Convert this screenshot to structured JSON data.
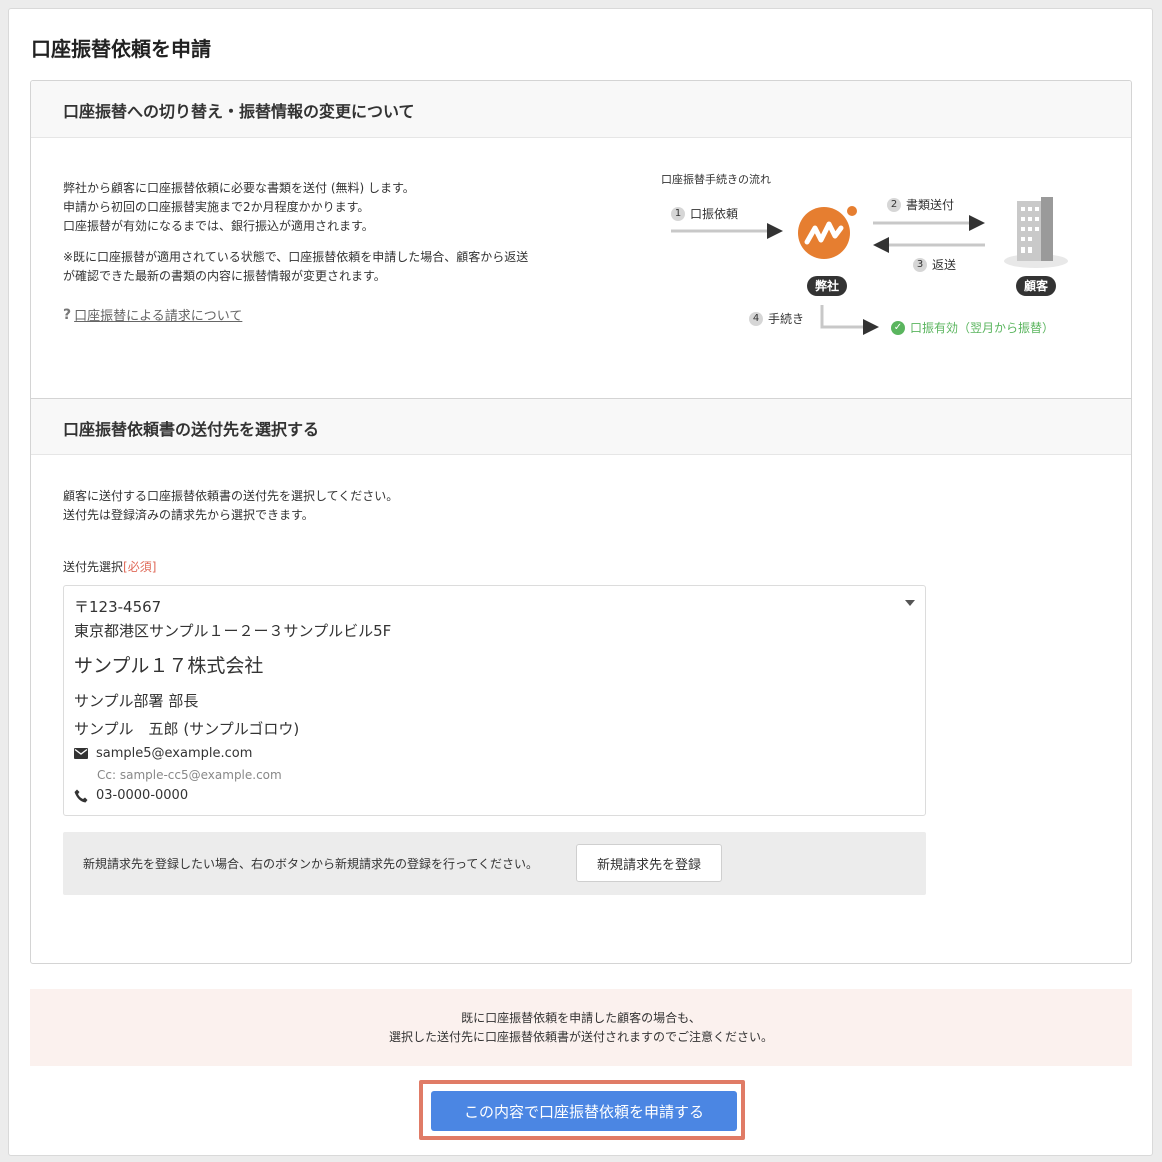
{
  "page": {
    "title": "口座振替依頼を申請"
  },
  "section1": {
    "heading": "口座振替への切り替え・振替情報の変更について",
    "lines": [
      "弊社から顧客に口座振替依頼に必要な書類を送付 (無料) します。",
      "申請から初回の口座振替実施まで2か月程度かかります。",
      "口座振替が有効になるまでは、銀行振込が適用されます。"
    ],
    "note_lines": [
      "※既に口座振替が適用されている状態で、口座振替依頼を申請した場合、顧客から返送",
      "が確認できた最新の書類の内容に振替情報が変更されます。"
    ],
    "help_link": "口座振替による請求について"
  },
  "flow": {
    "title": "口座振替手続きの流れ",
    "step1": {
      "num": "1",
      "label": "口振依頼"
    },
    "step2": {
      "num": "2",
      "label": "書類送付"
    },
    "step3": {
      "num": "3",
      "label": "返送"
    },
    "step4": {
      "num": "4",
      "label": "手続き"
    },
    "company_tag": "弊社",
    "customer_tag": "顧客",
    "status": "口振有効（翌月から振替）",
    "colors": {
      "logo": "#e67e30",
      "arrow": "#333333",
      "muted_arrow": "#c8c8c8",
      "ok": "#5ab55e"
    }
  },
  "section2": {
    "heading": "口座振替依頼書の送付先を選択する",
    "lines": [
      "顧客に送付する口座振替依頼書の送付先を選択してください。",
      "送付先は登録済みの請求先から選択できます。"
    ],
    "field_label": "送付先選択",
    "required_mark": "[必須]",
    "selected": {
      "postal": "〒123-4567",
      "address": "東京都港区サンプル１ー２ー３サンプルビル5F",
      "company": "サンプル１７株式会社",
      "department": "サンプル部署 部長",
      "person": "サンプル　五郎 (サンプルゴロウ)",
      "email": "sample5@example.com",
      "cc": "Cc: sample-cc5@example.com",
      "phone": "03-0000-0000"
    },
    "register_message": "新規請求先を登録したい場合、右のボタンから新規請求先の登録を行ってください。",
    "register_button": "新規請求先を登録"
  },
  "notice": {
    "line1": "既に口座振替依頼を申請した顧客の場合も、",
    "line2": "選択した送付先に口座振替依頼書が送付されますのでご注意ください。"
  },
  "submit": {
    "label": "この内容で口座振替依頼を申請する",
    "color": "#4b86e3",
    "highlight_color": "#e07b66"
  }
}
